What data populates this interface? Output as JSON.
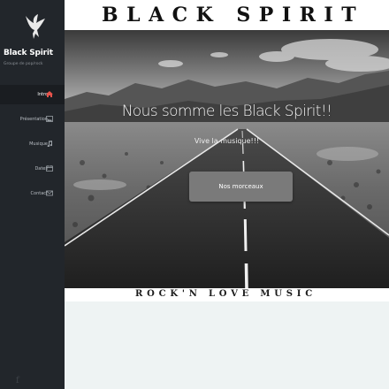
{
  "sidebar": {
    "brand": "Black Spirit",
    "tagline": "Groupe de pop/rock",
    "items": [
      {
        "label": "Intro",
        "icon": "home-icon",
        "active": true
      },
      {
        "label": "Présentation",
        "icon": "image-icon",
        "active": false
      },
      {
        "label": "Musique",
        "icon": "music-note-icon",
        "active": false
      },
      {
        "label": "Dates",
        "icon": "calendar-icon",
        "active": false
      },
      {
        "label": "Contact",
        "icon": "mail-icon",
        "active": false
      }
    ],
    "social": "f"
  },
  "header": {
    "title": "BLACK SPIRIT"
  },
  "hero": {
    "title": "Nous somme les Black Spirit!!",
    "subtitle": "Vive la musique!!!",
    "button_label": "Nos morceaux"
  },
  "strip": {
    "text": "ROCK'N LOVE MUSIC"
  },
  "colors": {
    "sidebar_bg": "#22262b",
    "active_icon": "#e8534b",
    "button_bg": "#7a7a7a",
    "lower_bg": "#eef3f3"
  }
}
